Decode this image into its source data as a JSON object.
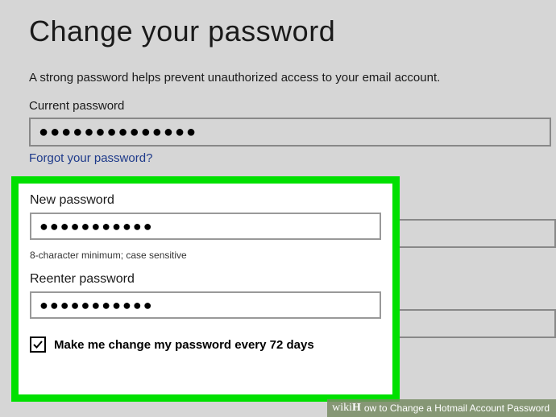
{
  "heading": "Change your password",
  "subtitle": "A strong password helps prevent unauthorized access to your email account.",
  "current": {
    "label": "Current password",
    "value": "●●●●●●●●●●●●●●"
  },
  "forgot_link": "Forgot your password?",
  "new_pw": {
    "label": "New password",
    "value": "●●●●●●●●●●●",
    "hint": "8-character minimum; case sensitive"
  },
  "reenter": {
    "label": "Reenter password",
    "value": "●●●●●●●●●●●"
  },
  "checkbox": {
    "checked": true,
    "label": "Make me change my password every 72 days"
  },
  "watermark": {
    "brand_prefix": "wiki",
    "brand_suffix": "H",
    "title": "ow to Change a Hotmail Account Password"
  }
}
